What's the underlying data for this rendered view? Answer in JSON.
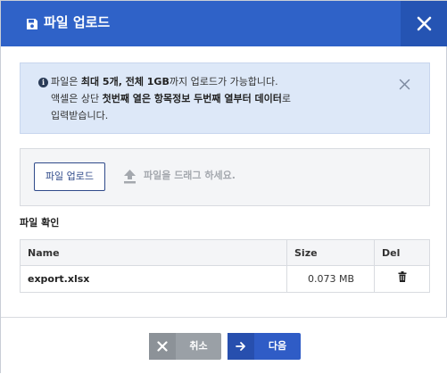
{
  "dialog": {
    "title": "파일 업로드",
    "title_icon": "save-disk-icon",
    "close_icon": "close-icon"
  },
  "notice": {
    "line1_pre": "파일은 ",
    "line1_bold": "최대 5개, 전체 1GB",
    "line1_post": "까지 업로드가 가능합니다.",
    "line2_pre": "액셀은 상단 ",
    "line2_bold": "첫번째 열은 항목정보 두번째 열부터 데이터",
    "line2_post": "로",
    "line3": "입력받습니다.",
    "info_icon": "i",
    "close_icon": "close-icon"
  },
  "upload": {
    "button_label": "파일 업로드",
    "drop_text": "파일을 드래그 하세요.",
    "drop_icon": "upload-arrow-icon"
  },
  "files": {
    "section_title": "파일 확인",
    "columns": [
      "Name",
      "Size",
      "Del"
    ],
    "rows": [
      {
        "name": "export.xlsx",
        "size": "0.073 MB",
        "del_icon": "trash-icon"
      }
    ]
  },
  "footer": {
    "cancel_label": "취소",
    "next_label": "다음"
  },
  "colors": {
    "header": "#2f62c8",
    "notice_bg": "#dde8f8",
    "next_button": "#2f5cc6",
    "cancel_button": "#9aa0a6"
  }
}
